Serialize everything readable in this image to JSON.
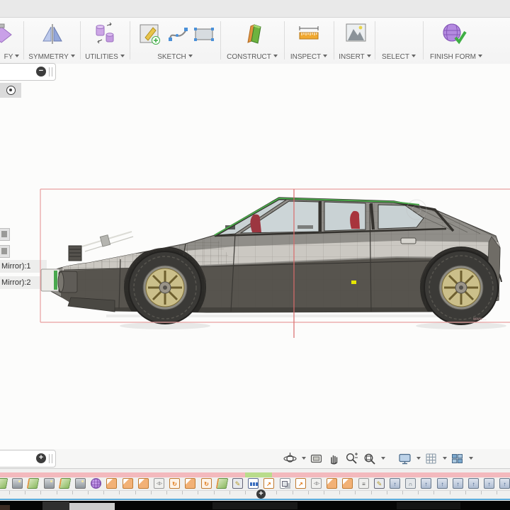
{
  "toolbar": {
    "groups": [
      {
        "id": "modify",
        "label": "FY"
      },
      {
        "id": "symmetry",
        "label": "SYMMETRY"
      },
      {
        "id": "utilities",
        "label": "UTILITIES"
      },
      {
        "id": "sketch",
        "label": "SKETCH"
      },
      {
        "id": "construct",
        "label": "CONSTRUCT"
      },
      {
        "id": "inspect",
        "label": "INSPECT"
      },
      {
        "id": "insert",
        "label": "INSERT"
      },
      {
        "id": "select",
        "label": "SELECT",
        "active": true
      },
      {
        "id": "finish_form",
        "label": "FINISH FORM"
      }
    ]
  },
  "browser": {
    "collapse_glyph": "−",
    "expand_glyph": "+",
    "items": [
      {
        "label": "Mirror):1"
      },
      {
        "label": "Mirror):2"
      }
    ]
  },
  "viewport": {
    "selection_box_color": "#e8a0a0",
    "axis_line_color": "#d96b6b",
    "highlight_edge_color": "#4aa84a",
    "selected_point_color": "#e6e600",
    "watermark": "www…"
  },
  "nav_bar": {
    "icons": [
      {
        "name": "orbit",
        "dropdown": true
      },
      {
        "name": "look-at",
        "dropdown": false
      },
      {
        "name": "pan",
        "dropdown": false
      },
      {
        "name": "zoom",
        "dropdown": false
      },
      {
        "name": "fit",
        "dropdown": true
      },
      {
        "name": "display-settings",
        "dropdown": true
      },
      {
        "name": "grid-snap",
        "dropdown": true
      },
      {
        "name": "viewports",
        "dropdown": true
      }
    ]
  },
  "timeline": {
    "playhead_glyph": "+",
    "icons": [
      "plane",
      "canvas",
      "plane",
      "canvas",
      "plane",
      "canvas",
      "form",
      "corner",
      "corner",
      "corner",
      "mirror",
      "revolve",
      "corner",
      "revolve",
      "plane",
      "sketch",
      "pattern",
      "pull",
      "combine",
      "pull",
      "mirror",
      "corner",
      "corner",
      "stitch",
      "sketch",
      "extrude",
      "fillet",
      "extrude",
      "extrude",
      "extrude",
      "extrude",
      "extrude",
      "extrude"
    ]
  }
}
